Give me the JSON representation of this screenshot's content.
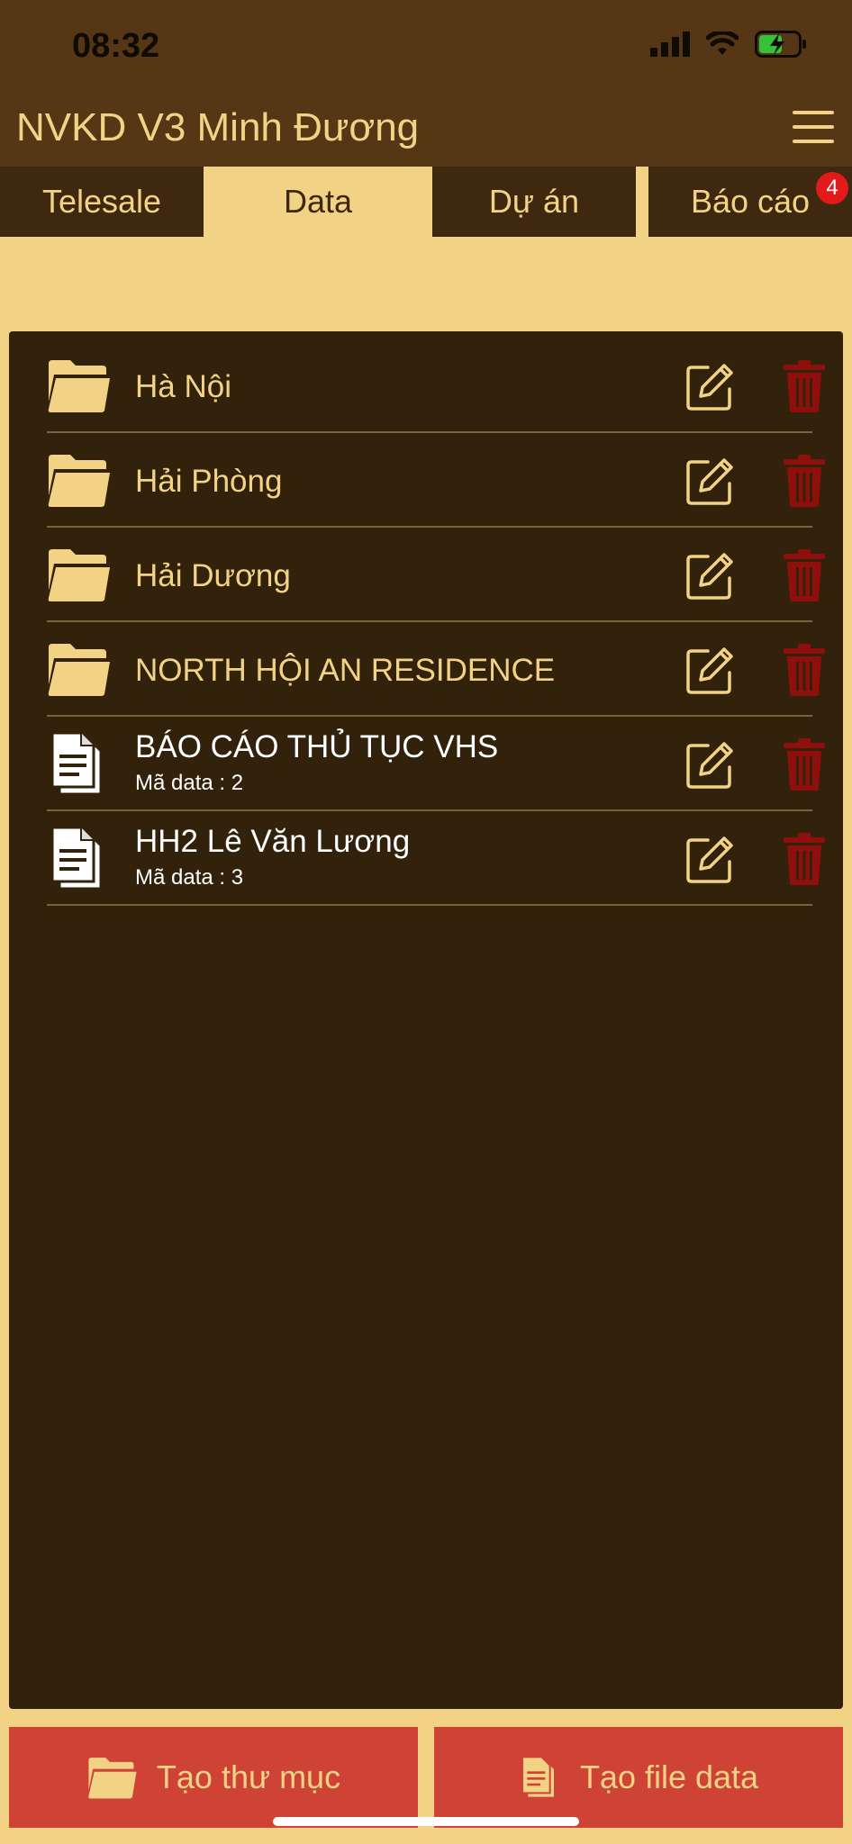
{
  "status": {
    "time": "08:32"
  },
  "header": {
    "title": "NVKD V3 Minh Đương"
  },
  "tabs": [
    {
      "label": "Telesale"
    },
    {
      "label": "Data"
    },
    {
      "label": "Dự án"
    },
    {
      "label": "Báo cáo",
      "badge": "4"
    }
  ],
  "items": [
    {
      "type": "folder",
      "title": "Hà Nội"
    },
    {
      "type": "folder",
      "title": "Hải Phòng"
    },
    {
      "type": "folder",
      "title": "Hải Dương"
    },
    {
      "type": "folder",
      "title": "NORTH HỘI AN RESIDENCE"
    },
    {
      "type": "file",
      "title": "BÁO CÁO THỦ TỤC VHS",
      "sub": "Mã data : 2"
    },
    {
      "type": "file",
      "title": "HH2 Lê Văn Lương",
      "sub": "Mã data : 3"
    }
  ],
  "actions": {
    "create_folder": "Tạo thư mục",
    "create_file": "Tạo file data"
  },
  "colors": {
    "background": "#F2D386",
    "header": "#553716",
    "panel": "#32220b",
    "delete": "#8e0f0b",
    "button": "#CE4336"
  },
  "icons": {
    "row_folder": "folder-icon",
    "row_file": "file-icon",
    "edit": "edit-icon",
    "delete": "trash-icon",
    "menu": "hamburger-menu-icon"
  }
}
